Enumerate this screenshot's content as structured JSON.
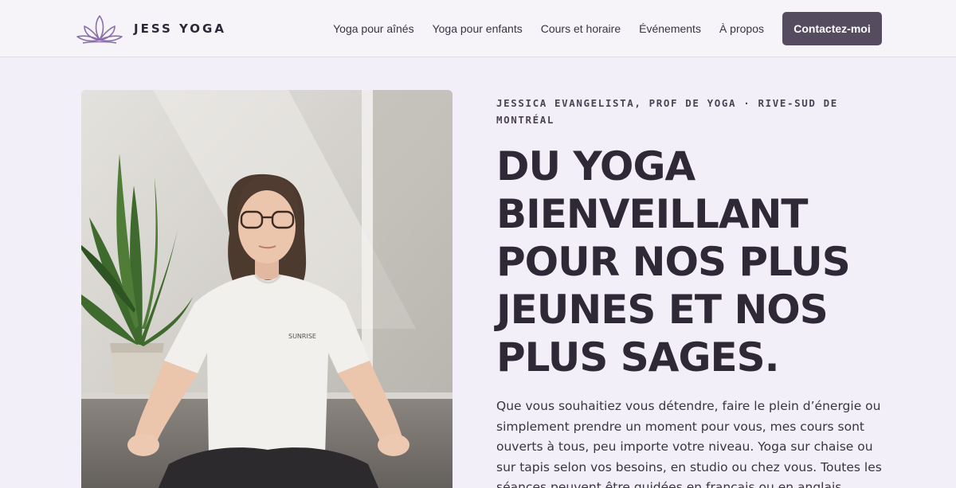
{
  "brand": {
    "name": "JESS YOGA",
    "logo_icon": "lotus-icon",
    "accent": "#8a6fa8"
  },
  "nav": {
    "items": [
      {
        "label": "Yoga pour aînés"
      },
      {
        "label": "Yoga pour enfants"
      },
      {
        "label": "Cours et horaire"
      },
      {
        "label": "Événements"
      },
      {
        "label": "À propos"
      }
    ],
    "cta_label": "Contactez-moi",
    "cta_color": "#554c5f"
  },
  "hero": {
    "eyebrow": "JESSICA EVANGELISTA, PROF DE YOGA · RIVE-SUD DE MONTRÉAL",
    "headline": "DU YOGA BIENVEILLANT POUR NOS PLUS JEUNES ET NOS PLUS SAGES.",
    "intro": "Que vous souhaitiez vous détendre, faire le plein d’énergie ou simplement prendre un moment pour vous, mes cours sont ouverts à tous, peu importe votre niveau. Yoga sur chaise ou sur tapis selon vos besoins, en studio ou chez vous. Toutes les séances peuvent être guidées en français ou en anglais.",
    "photo_shirt_text": "SUNRISE"
  },
  "colors": {
    "page_bg": "#f3eff8",
    "heading": "#2f2937"
  }
}
